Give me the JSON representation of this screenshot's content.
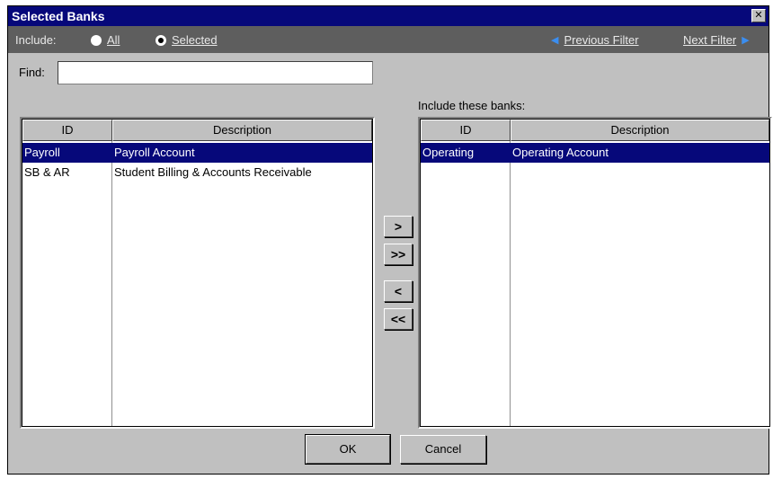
{
  "window": {
    "title": "Selected Banks",
    "close_glyph": "✕"
  },
  "filterbar": {
    "include_label": "Include:",
    "radio_all": "All",
    "radio_selected": "Selected",
    "selected_option": "Selected",
    "previous_filter": "Previous Filter",
    "next_filter": "Next Filter"
  },
  "find": {
    "label": "Find:",
    "value": ""
  },
  "available": {
    "columns": [
      "ID",
      "Description"
    ],
    "rows": [
      {
        "id": "Payroll",
        "description": "Payroll Account",
        "selected": true
      },
      {
        "id": "SB & AR",
        "description": "Student Billing & Accounts Receivable",
        "selected": false
      }
    ]
  },
  "included": {
    "label": "Include these banks:",
    "columns": [
      "ID",
      "Description"
    ],
    "rows": [
      {
        "id": "Operating",
        "description": "Operating Account",
        "selected": true
      }
    ]
  },
  "transfer": {
    "add": ">",
    "add_all": ">>",
    "remove": "<",
    "remove_all": "<<"
  },
  "buttons": {
    "ok": "OK",
    "cancel": "Cancel"
  },
  "colors": {
    "title_bg": "#06087a",
    "filterbar_bg": "#5e5e5e",
    "selection_bg": "#06087a",
    "nav_arrow": "#3b8ef0"
  }
}
